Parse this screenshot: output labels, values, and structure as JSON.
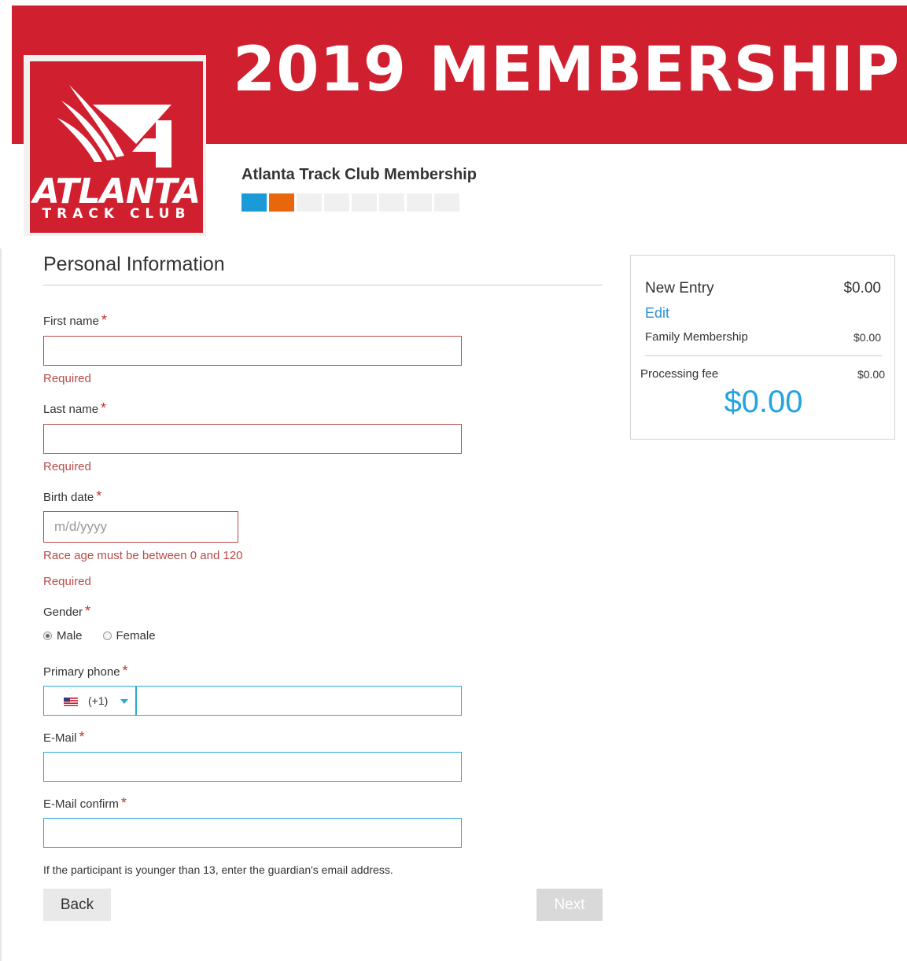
{
  "header": {
    "banner_title": "2019 MEMBERSHIP",
    "logo_main": "ATLANTA",
    "logo_sub": "TRACK CLUB",
    "event_title": "Atlanta Track Club Membership",
    "progress_steps": 8,
    "progress_colors": [
      "#1a9bd7",
      "#e8670c",
      "#f0f0f0"
    ]
  },
  "form": {
    "section_title": "Personal Information",
    "required_mark": "*",
    "first_name": {
      "label": "First name",
      "value": "",
      "error": "Required"
    },
    "last_name": {
      "label": "Last name",
      "value": "",
      "error": "Required"
    },
    "birth_date": {
      "label": "Birth date",
      "placeholder": "m/d/yyyy",
      "error_range": "Race age must be between 0 and 120",
      "error_required": "Required"
    },
    "gender": {
      "label": "Gender",
      "options": [
        "Male",
        "Female"
      ],
      "selected": "Male"
    },
    "phone": {
      "label": "Primary phone",
      "country_code": "(+1)",
      "flag": "us-flag-icon",
      "value": ""
    },
    "email": {
      "label": "E-Mail",
      "value": ""
    },
    "email_confirm": {
      "label": "E-Mail confirm",
      "value": ""
    },
    "help_text": "If the participant is younger than 13, enter the guardian's email address."
  },
  "buttons": {
    "back": "Back",
    "next": "Next"
  },
  "summary": {
    "entry_label": "New Entry",
    "entry_amount": "$0.00",
    "edit_label": "Edit",
    "item_label": "Family Membership",
    "item_amount": "$0.00",
    "fee_label": "Processing fee",
    "fee_amount": "$0.00",
    "total": "$0.00"
  },
  "colors": {
    "brand_red": "#d0202f",
    "error": "#b94a48",
    "focus_border": "#29a9d8",
    "total_blue": "#23a3e0",
    "link": "#2a8fd6"
  }
}
